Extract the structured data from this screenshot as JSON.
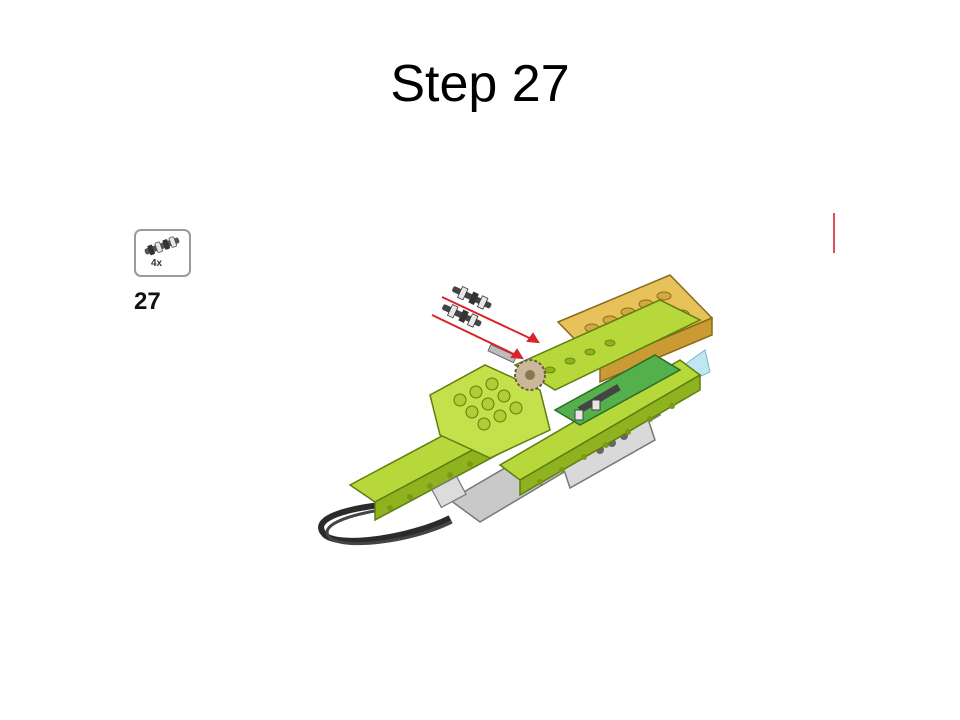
{
  "slide": {
    "title": "Step 27"
  },
  "parts_callout": {
    "quantity": "4x",
    "part_icon": "axle-connector-peg-icon"
  },
  "step": {
    "number": "27"
  },
  "colors": {
    "lime": "#b6d83a",
    "lime_dark": "#8fb21f",
    "yellow_tan": "#e7c15a",
    "green": "#54b04a",
    "gray": "#c8c8c8",
    "arrow_red": "#d7262b",
    "accent_edge": "#e24b5a"
  }
}
